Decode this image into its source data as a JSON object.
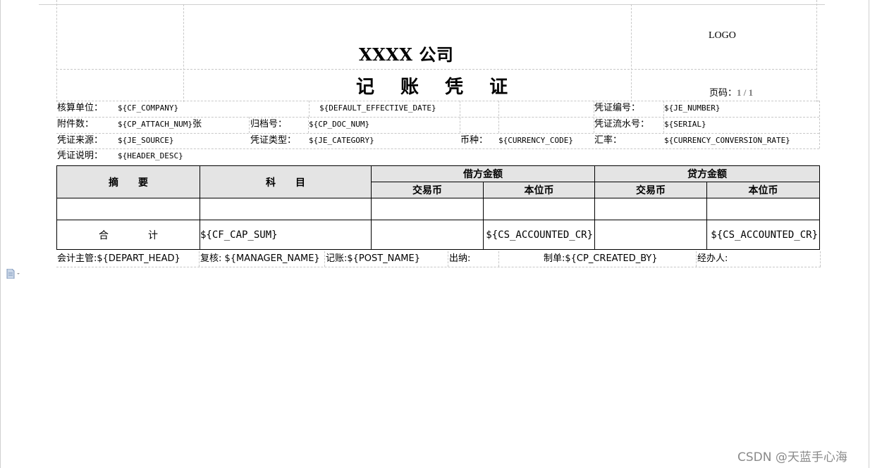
{
  "header": {
    "company_title": "XXXX 公司",
    "voucher_title": "记 账 凭 证",
    "logo_text": "LOGO",
    "page_label": "页码：",
    "page_value": "1 / 1"
  },
  "info": {
    "company_label": "核算单位：",
    "company_value": "${CF_COMPANY}",
    "effective_date_value": "${DEFAULT_EFFECTIVE_DATE}",
    "voucher_no_label": "凭证编号：",
    "voucher_no_value": "${JE_NUMBER}",
    "attach_label": "附件数：",
    "attach_value": "${CP_ATTACH_NUM}",
    "attach_unit": "张",
    "doc_no_label": "归档号：",
    "doc_no_value": "${CP_DOC_NUM}",
    "serial_label": "凭证流水号：",
    "serial_value": "${SERIAL}",
    "source_label": "凭证来源：",
    "source_value": "${JE_SOURCE}",
    "type_label": "凭证类型：",
    "type_value": "${JE_CATEGORY}",
    "currency_label": "币种：",
    "currency_value": "${CURRENCY_CODE}",
    "rate_label": "汇率：",
    "rate_value": "${CURRENCY_CONVERSION_RATE}",
    "desc_label": "凭证说明：",
    "desc_value": "${HEADER_DESC}"
  },
  "table": {
    "summary_header": "摘　　要",
    "account_header": "科　　目",
    "debit_header": "借方金额",
    "credit_header": "贷方金额",
    "trans_currency": "交易币",
    "local_currency": "本位币",
    "total_label": "合　　　　计",
    "total_cap_sum": "${CF_CAP_SUM}",
    "debit_local_total": "${CS_ACCOUNTED_CR}",
    "credit_local_total": "${CS_ACCOUNTED_CR}"
  },
  "signatures": {
    "chief": "会计主管:${DEPART_HEAD}",
    "review": "复核: ${MANAGER_NAME}",
    "bookkeeper": "记账:${POST_NAME}",
    "cashier": "出纳:",
    "preparer": "制单:${CP_CREATED_BY}",
    "handler": "经办人:"
  },
  "watermark": "CSDN @天蓝手心海"
}
